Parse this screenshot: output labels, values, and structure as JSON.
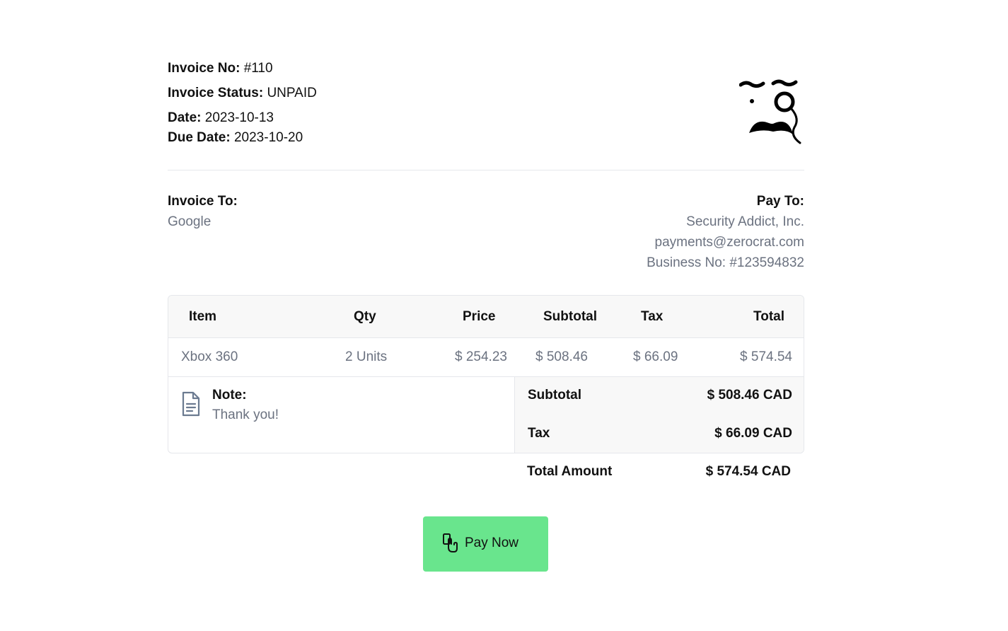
{
  "invoice": {
    "no_label": "Invoice No:",
    "no_value": "#110",
    "status_label": "Invoice Status:",
    "status_value": "UNPAID",
    "date_label": "Date:",
    "date_value": "2023-10-13",
    "due_label": "Due Date:",
    "due_value": "2023-10-20"
  },
  "logo": {
    "icon": "monocle-mustache-logo"
  },
  "invoice_to": {
    "title": "Invoice To:",
    "name": "Google"
  },
  "pay_to": {
    "title": "Pay To:",
    "lines": [
      "Security Addict, Inc.",
      "payments@zerocrat.com",
      "Business No: #123594832"
    ]
  },
  "table": {
    "headers": {
      "item": "Item",
      "qty": "Qty",
      "price": "Price",
      "subtotal": "Subtotal",
      "tax": "Tax",
      "total": "Total"
    },
    "rows": [
      {
        "item": "Xbox 360",
        "qty": "2 Units",
        "price": "$ 254.23",
        "subtotal": "$ 508.46",
        "tax": "$ 66.09",
        "total": "$ 574.54"
      }
    ]
  },
  "note": {
    "icon": "document-icon",
    "label": "Note:",
    "text": "Thank you!"
  },
  "summary": {
    "subtotal_label": "Subtotal",
    "subtotal_value": "$ 508.46 CAD",
    "tax_label": "Tax",
    "tax_value": "$ 66.09 CAD",
    "total_label": "Total Amount",
    "total_value": "$ 574.54 CAD"
  },
  "pay_button": {
    "icon": "hand-card-icon",
    "label": "Pay Now",
    "color": "#69e58d"
  }
}
